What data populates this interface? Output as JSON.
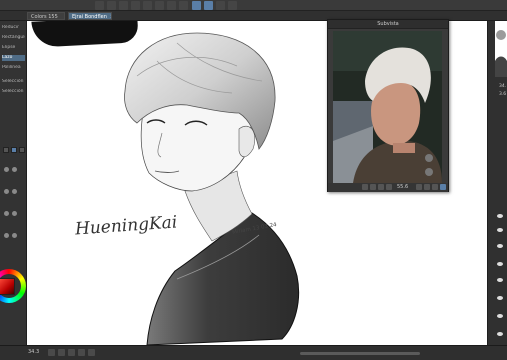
{
  "tabs": [
    {
      "label": "Colors 155",
      "active": false
    },
    {
      "label": "Ejrai Bondflen",
      "active": true
    }
  ],
  "left_panel": {
    "items": [
      "Reducir",
      "Rectángulo",
      "Elipse",
      "Lazo",
      "Polilínea",
      "Selección",
      "Selección"
    ]
  },
  "reference_window": {
    "title": "Subvista",
    "zoom": "55.6"
  },
  "canvas": {
    "signature": "HueningKai",
    "date_note": "Miriam 13 03 24"
  },
  "right_panel": {
    "value_1": "34.",
    "value_2": "3.6"
  },
  "status_bar": {
    "zoom": "34.3"
  },
  "colors": {
    "accent": "#4f6c86",
    "primary_color": "#d00000"
  }
}
